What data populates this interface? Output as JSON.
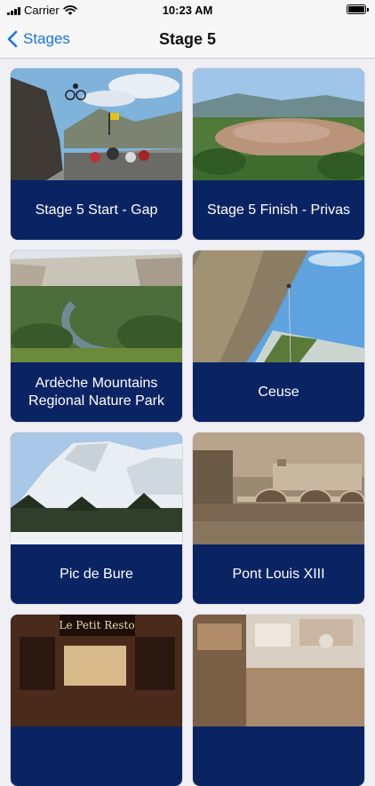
{
  "status_bar": {
    "carrier": "Carrier",
    "time": "10:23 AM",
    "icons": [
      "signal-icon",
      "wifi-icon",
      "battery-icon"
    ]
  },
  "nav": {
    "back_label": "Stages",
    "title": "Stage 5"
  },
  "colors": {
    "accent": "#1a73e8",
    "card_label_bg": "#0a2463",
    "background": "#efeff4"
  },
  "cards": [
    {
      "label": "Stage 5 Start - Gap"
    },
    {
      "label": "Stage 5 Finish - Privas"
    },
    {
      "label": "Ardèche Mountains Regional Nature Park"
    },
    {
      "label": "Ceuse"
    },
    {
      "label": "Pic de Bure"
    },
    {
      "label": "Pont Louis XIII"
    },
    {
      "label": "",
      "sign_text": "Le Petit Resto"
    },
    {
      "label": ""
    }
  ]
}
